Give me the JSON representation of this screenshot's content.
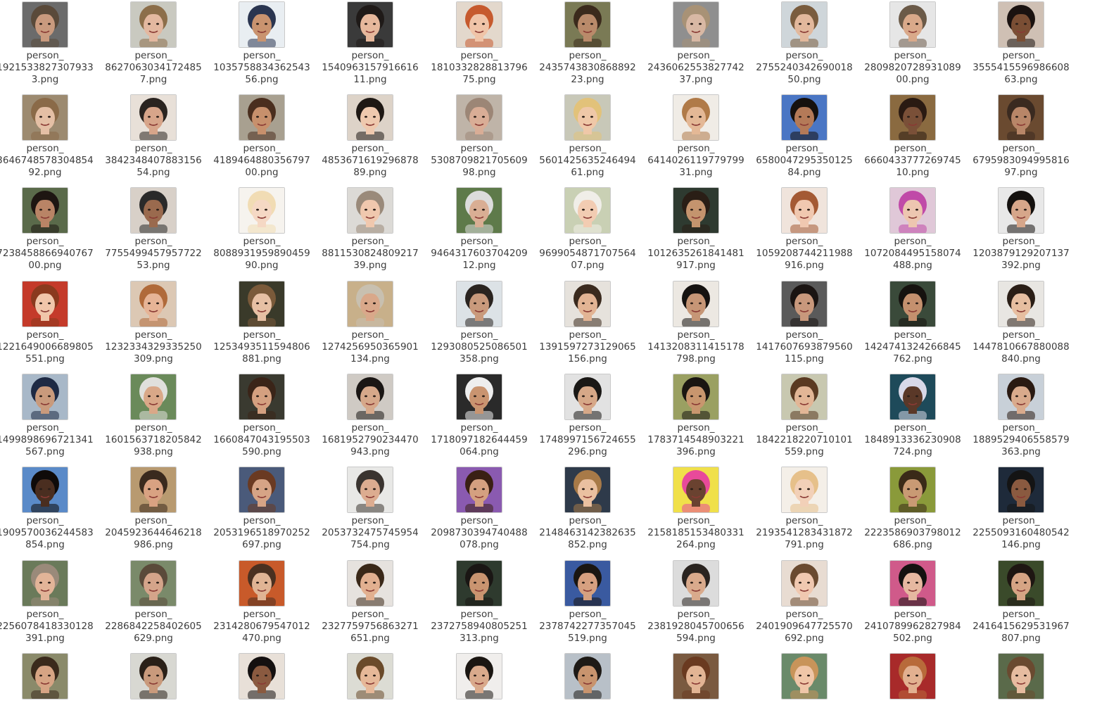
{
  "files": [
    {
      "line1": "person_",
      "line2": "1921533827307933",
      "line3": "3.png",
      "skin": "#c99a7e",
      "hair": "#5a4a3a",
      "bg": "#6b6b6b"
    },
    {
      "line1": "person_",
      "line2": "8627063034172485",
      "line3": "7.png",
      "skin": "#e3b8a0",
      "hair": "#8c6e4a",
      "bg": "#c9c9c0"
    },
    {
      "line1": "person_",
      "line2": "1035758834362543",
      "line3": "56.png",
      "skin": "#c9936f",
      "hair": "#2a3550",
      "bg": "#e9eef2"
    },
    {
      "line1": "person_",
      "line2": "1540963157916616",
      "line3": "11.png",
      "skin": "#e6b89c",
      "hair": "#1f1a18",
      "bg": "#3a3a3a"
    },
    {
      "line1": "person_",
      "line2": "1810332828813796",
      "line3": "75.png",
      "skin": "#f0c4a8",
      "hair": "#c65a2e",
      "bg": "#e3d8cc"
    },
    {
      "line1": "person_",
      "line2": "2435743830868892",
      "line3": "23.png",
      "skin": "#b98a6a",
      "hair": "#3b2a1c",
      "bg": "#7a7a55"
    },
    {
      "line1": "person_",
      "line2": "2436062553827742",
      "line3": "37.png",
      "skin": "#d8b8a4",
      "hair": "#a89276",
      "bg": "#8f8f8f"
    },
    {
      "line1": "person_",
      "line2": "2755240342690018",
      "line3": "50.png",
      "skin": "#e2b89c",
      "hair": "#7a5c3e",
      "bg": "#cfd6da"
    },
    {
      "line1": "person_",
      "line2": "2809820728931089",
      "line3": "00.png",
      "skin": "#d9a98a",
      "hair": "#6b5a48",
      "bg": "#e6e6e6"
    },
    {
      "line1": "person_",
      "line2": "3555415596986608",
      "line3": "63.png",
      "skin": "#7a4e34",
      "hair": "#1a1210",
      "bg": "#cfc0b4"
    },
    {
      "line1": "person_",
      "line2": "3646748578304854",
      "line3": "92.png",
      "skin": "#e4bfa5",
      "hair": "#8a6a48",
      "bg": "#9c8a70"
    },
    {
      "line1": "person_",
      "line2": "3842348407883156",
      "line3": "54.png",
      "skin": "#d7a58a",
      "hair": "#2a2420",
      "bg": "#e8e0d8"
    },
    {
      "line1": "person_",
      "line2": "4189464880356797",
      "line3": "00.png",
      "skin": "#c7906c",
      "hair": "#4a2e1e",
      "bg": "#a8a090"
    },
    {
      "line1": "person_",
      "line2": "4853671619296878",
      "line3": "89.png",
      "skin": "#efc9ae",
      "hair": "#1e1814",
      "bg": "#ddd3c8"
    },
    {
      "line1": "person_",
      "line2": "5308709821705609",
      "line3": "98.png",
      "skin": "#d9ad96",
      "hair": "#9c8676",
      "bg": "#bfb4a8"
    },
    {
      "line1": "person_",
      "line2": "5601425635246494",
      "line3": "61.png",
      "skin": "#efc8a8",
      "hair": "#e2c27a",
      "bg": "#c8c8b8"
    },
    {
      "line1": "person_",
      "line2": "6414026119779799",
      "line3": "31.png",
      "skin": "#e4b896",
      "hair": "#b07a48",
      "bg": "#f0ece6"
    },
    {
      "line1": "person_",
      "line2": "6580047295350125",
      "line3": "84.png",
      "skin": "#b47a58",
      "hair": "#16110e",
      "bg": "#4a76c4"
    },
    {
      "line1": "person_",
      "line2": "6660433777269745",
      "line3": "10.png",
      "skin": "#7a5038",
      "hair": "#2a1a12",
      "bg": "#8a6a40"
    },
    {
      "line1": "person_",
      "line2": "6795983094995816",
      "line3": "97.png",
      "skin": "#b88668",
      "hair": "#3a2a20",
      "bg": "#6a4a30"
    },
    {
      "line1": "person_",
      "line2": "7238458866940767",
      "line3": "00.png",
      "skin": "#b98466",
      "hair": "#1e1612",
      "bg": "#5a6a4a"
    },
    {
      "line1": "person_",
      "line2": "7755499457957722",
      "line3": "53.png",
      "skin": "#9a6a4e",
      "hair": "#2a2a2a",
      "bg": "#d8d0c8"
    },
    {
      "line1": "person_",
      "line2": "8088931959890459",
      "line3": "90.png",
      "skin": "#f5d8c4",
      "hair": "#f1dcb4",
      "bg": "#f6f3ee"
    },
    {
      "line1": "person_",
      "line2": "8811530824809217",
      "line3": "39.png",
      "skin": "#f0c8ae",
      "hair": "#9a8a7a",
      "bg": "#dcdad6"
    },
    {
      "line1": "person_",
      "line2": "9464317603704209",
      "line3": "12.png",
      "skin": "#d9ae94",
      "hair": "#dcdcdc",
      "bg": "#5e7a4a"
    },
    {
      "line1": "person_",
      "line2": "9699054871707564",
      "line3": "07.png",
      "skin": "#f2ccb2",
      "hair": "#f0eee8",
      "bg": "#c9d0b4"
    },
    {
      "line1": "person_",
      "line2": "1012635261841481",
      "line3": "917.png",
      "skin": "#c4946e",
      "hair": "#2a1e16",
      "bg": "#2e3a30"
    },
    {
      "line1": "person_",
      "line2": "1059208744211988",
      "line3": "916.png",
      "skin": "#f0c8b0",
      "hair": "#a45a34",
      "bg": "#f0e4dc"
    },
    {
      "line1": "person_",
      "line2": "1072084495158074",
      "line3": "488.png",
      "skin": "#edc6b0",
      "hair": "#c04aa8",
      "bg": "#e0c8d8"
    },
    {
      "line1": "person_",
      "line2": "1203879129207137",
      "line3": "392.png",
      "skin": "#d6a68a",
      "hair": "#14110f",
      "bg": "#e8e8e8"
    },
    {
      "line1": "person_",
      "line2": "1221649006689805",
      "line3": "551.png",
      "skin": "#f0c6aa",
      "hair": "#8a3a1e",
      "bg": "#c43a2a"
    },
    {
      "line1": "person_",
      "line2": "1232334329335250",
      "line3": "309.png",
      "skin": "#e6b496",
      "hair": "#b06a3a",
      "bg": "#dcc8b4"
    },
    {
      "line1": "person_",
      "line2": "1253493511594806",
      "line3": "881.png",
      "skin": "#e6c0a4",
      "hair": "#7a5a3a",
      "bg": "#3a3a2a"
    },
    {
      "line1": "person_",
      "line2": "1274256950365901",
      "line3": "134.png",
      "skin": "#d9a88a",
      "hair": "#c8c0b0",
      "bg": "#c8b08a"
    },
    {
      "line1": "person_",
      "line2": "1293080525086501",
      "line3": "358.png",
      "skin": "#c99a7c",
      "hair": "#2a2420",
      "bg": "#dce2e6"
    },
    {
      "line1": "person_",
      "line2": "1391597273129065",
      "line3": "156.png",
      "skin": "#e2b494",
      "hair": "#3a2a1e",
      "bg": "#e6e2dc"
    },
    {
      "line1": "person_",
      "line2": "1413208311415178",
      "line3": "798.png",
      "skin": "#c69676",
      "hair": "#151210",
      "bg": "#ece8e2"
    },
    {
      "line1": "person_",
      "line2": "1417607693879560",
      "line3": "115.png",
      "skin": "#c8987c",
      "hair": "#1a1412",
      "bg": "#5a5a5a"
    },
    {
      "line1": "person_",
      "line2": "1424741324266845",
      "line3": "762.png",
      "skin": "#c4906e",
      "hair": "#16120f",
      "bg": "#3a4a3a"
    },
    {
      "line1": "person_",
      "line2": "1447810667880088",
      "line3": "840.png",
      "skin": "#e6bea0",
      "hair": "#2a1e16",
      "bg": "#e8e6e2"
    },
    {
      "line1": "person_",
      "line2": "1499898696721341",
      "line3": "567.png",
      "skin": "#c99a7c",
      "hair": "#1e2a44",
      "bg": "#a8b8c8"
    },
    {
      "line1": "person_",
      "line2": "1601563718205842",
      "line3": "938.png",
      "skin": "#d9a888",
      "hair": "#e0e0dc",
      "bg": "#6a8a5a"
    },
    {
      "line1": "person_",
      "line2": "1660847043195503",
      "line3": "590.png",
      "skin": "#d4a080",
      "hair": "#3a2418",
      "bg": "#3a3a30"
    },
    {
      "line1": "person_",
      "line2": "1681952790234470",
      "line3": "943.png",
      "skin": "#d6a88a",
      "hair": "#1a1614",
      "bg": "#cfcac4"
    },
    {
      "line1": "person_",
      "line2": "1718097182644459",
      "line3": "064.png",
      "skin": "#c99470",
      "hair": "#eeeeee",
      "bg": "#2a2a2a"
    },
    {
      "line1": "person_",
      "line2": "1748997156724655",
      "line3": "296.png",
      "skin": "#d6a888",
      "hair": "#1a1816",
      "bg": "#e2e2e2"
    },
    {
      "line1": "person_",
      "line2": "1783714548903221",
      "line3": "396.png",
      "skin": "#c8966e",
      "hair": "#1a1612",
      "bg": "#9aa062"
    },
    {
      "line1": "person_",
      "line2": "1842218220710101",
      "line3": "559.png",
      "skin": "#e2b696",
      "hair": "#5a3a22",
      "bg": "#c8c8b0"
    },
    {
      "line1": "person_",
      "line2": "1848913336230908",
      "line3": "724.png",
      "skin": "#5a3828",
      "hair": "#d8d8e8",
      "bg": "#1e4a5a"
    },
    {
      "line1": "person_",
      "line2": "1889529406558579",
      "line3": "363.png",
      "skin": "#d9aa8c",
      "hair": "#2a1a12",
      "bg": "#c8d0d8"
    },
    {
      "line1": "person_",
      "line2": "1909570036244583",
      "line3": "854.png",
      "skin": "#4a2e20",
      "hair": "#0f0b09",
      "bg": "#5a8ac8"
    },
    {
      "line1": "person_",
      "line2": "2045923644646218",
      "line3": "986.png",
      "skin": "#d9a282",
      "hair": "#3a2a1e",
      "bg": "#b89a70"
    },
    {
      "line1": "person_",
      "line2": "2053196518970252",
      "line3": "697.png",
      "skin": "#d6a486",
      "hair": "#6a3a22",
      "bg": "#4a5a7a"
    },
    {
      "line1": "person_",
      "line2": "2053732475745954",
      "line3": "754.png",
      "skin": "#dcac90",
      "hair": "#3a3430",
      "bg": "#e8e8e6"
    },
    {
      "line1": "person_",
      "line2": "2098730394740488",
      "line3": "078.png",
      "skin": "#d4a080",
      "hair": "#3a2014",
      "bg": "#8a5ab0"
    },
    {
      "line1": "person_",
      "line2": "2148463142382635",
      "line3": "852.png",
      "skin": "#eac0a0",
      "hair": "#a87a48",
      "bg": "#2e3a4a"
    },
    {
      "line1": "person_",
      "line2": "2158185153480331",
      "line3": "264.png",
      "skin": "#6a4230",
      "hair": "#e84a9a",
      "bg": "#f0e04a"
    },
    {
      "line1": "person_",
      "line2": "2193541283431872",
      "line3": "791.png",
      "skin": "#f2d0b8",
      "hair": "#e6c08a",
      "bg": "#f4efe8"
    },
    {
      "line1": "person_",
      "line2": "2223586903798012",
      "line3": "686.png",
      "skin": "#c99a74",
      "hair": "#3a2a18",
      "bg": "#8a9a3a"
    },
    {
      "line1": "person_",
      "line2": "2255093160480542",
      "line3": "146.png",
      "skin": "#8a5a40",
      "hair": "#141414",
      "bg": "#1e2a3a"
    },
    {
      "line1": "person_",
      "line2": "2256078418330128",
      "line3": "391.png",
      "skin": "#e2b498",
      "hair": "#9a8a7a",
      "bg": "#6a7a5a"
    },
    {
      "line1": "person_",
      "line2": "2286842258402605",
      "line3": "629.png",
      "skin": "#d4a48a",
      "hair": "#5a4a3a",
      "bg": "#7a8a6a"
    },
    {
      "line1": "person_",
      "line2": "2314280679547012",
      "line3": "470.png",
      "skin": "#e0b494",
      "hair": "#4a3020",
      "bg": "#c85a2a"
    },
    {
      "line1": "person_",
      "line2": "2327759756863271",
      "line3": "651.png",
      "skin": "#e2b090",
      "hair": "#3a2818",
      "bg": "#e6e2de"
    },
    {
      "line1": "person_",
      "line2": "2372758940805251",
      "line3": "313.png",
      "skin": "#c99470",
      "hair": "#1a1614",
      "bg": "#2e3a2e"
    },
    {
      "line1": "person_",
      "line2": "2378742277357045",
      "line3": "519.png",
      "skin": "#d6a080",
      "hair": "#1a1612",
      "bg": "#3a5aa0"
    },
    {
      "line1": "person_",
      "line2": "2381928045700656",
      "line3": "594.png",
      "skin": "#d9aa8c",
      "hair": "#2a2420",
      "bg": "#dcdcdc"
    },
    {
      "line1": "person_",
      "line2": "2401909647725570",
      "line3": "692.png",
      "skin": "#f0c8b0",
      "hair": "#6a4a30",
      "bg": "#e8dcd2"
    },
    {
      "line1": "person_",
      "line2": "2410789962827984",
      "line3": "502.png",
      "skin": "#e6b8a0",
      "hair": "#141210",
      "bg": "#d05a8a"
    },
    {
      "line1": "person_",
      "line2": "2416415629531967",
      "line3": "807.png",
      "skin": "#d6a484",
      "hair": "#1e1612",
      "bg": "#3a4a2a"
    },
    {
      "line1": "",
      "line2": "",
      "line3": "",
      "skin": "#d6a484",
      "hair": "#3a2a1c",
      "bg": "#8a8a6a"
    },
    {
      "line1": "",
      "line2": "",
      "line3": "",
      "skin": "#c99a7c",
      "hair": "#2a2018",
      "bg": "#d8d8d2"
    },
    {
      "line1": "",
      "line2": "",
      "line3": "",
      "skin": "#8a5a40",
      "hair": "#141010",
      "bg": "#e8e0d8"
    },
    {
      "line1": "",
      "line2": "",
      "line3": "",
      "skin": "#e6b898",
      "hair": "#6a4a2a",
      "bg": "#dcdcd4"
    },
    {
      "line1": "",
      "line2": "",
      "line3": "",
      "skin": "#d9aa8c",
      "hair": "#1a1612",
      "bg": "#f0eeec"
    },
    {
      "line1": "",
      "line2": "",
      "line3": "",
      "skin": "#c8946e",
      "hair": "#1e1a16",
      "bg": "#b8c0c8"
    },
    {
      "line1": "",
      "line2": "",
      "line3": "",
      "skin": "#e2b494",
      "hair": "#6a3a20",
      "bg": "#7a5a40"
    },
    {
      "line1": "",
      "line2": "",
      "line3": "",
      "skin": "#efc6a8",
      "hair": "#c8945a",
      "bg": "#6a8a6a"
    },
    {
      "line1": "",
      "line2": "",
      "line3": "",
      "skin": "#e2b090",
      "hair": "#b86a3a",
      "bg": "#a82a2a"
    },
    {
      "line1": "",
      "line2": "",
      "line3": "",
      "skin": "#e6bca0",
      "hair": "#6a4a30",
      "bg": "#5a6a4a"
    }
  ]
}
